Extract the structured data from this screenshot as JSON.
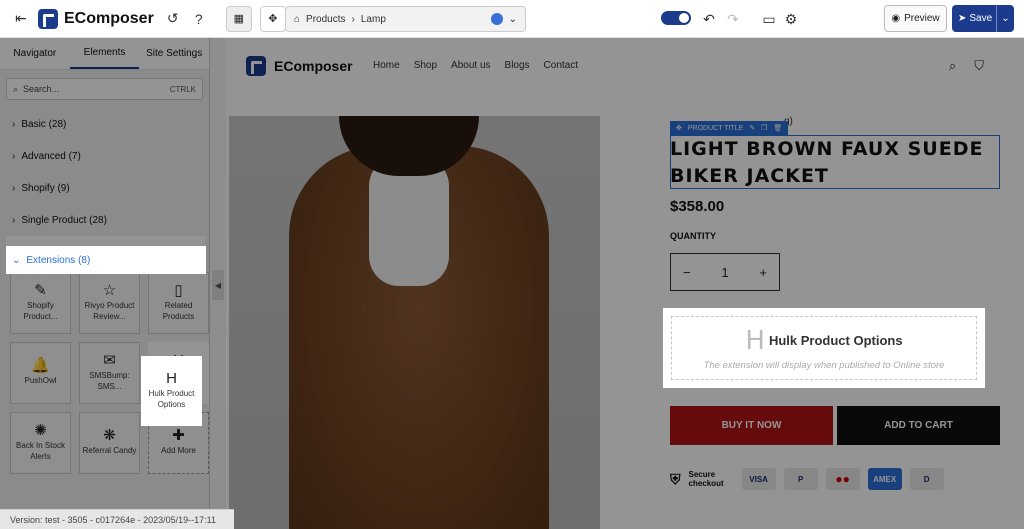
{
  "topbar": {
    "brand": "EComposer",
    "breadcrumb_root": "Products",
    "breadcrumb_page": "Lamp",
    "preview_label": "Preview",
    "save_label": "Save"
  },
  "left": {
    "tabs": [
      "Navigator",
      "Elements",
      "Site Settings"
    ],
    "search_placeholder": "Search...",
    "search_shortcut": "CTRLK",
    "categories": [
      {
        "label": "Basic (28)"
      },
      {
        "label": "Advanced (7)"
      },
      {
        "label": "Shopify (9)"
      },
      {
        "label": "Single Product (28)"
      },
      {
        "label": "Extensions (8)"
      }
    ],
    "cards": [
      {
        "label": "Shopify Product...",
        "icon": "✎"
      },
      {
        "label": "Rivyo Product Review...",
        "icon": "☆"
      },
      {
        "label": "Related Products",
        "icon": "▯"
      },
      {
        "label": "PushOwl",
        "icon": "🔔"
      },
      {
        "label": "SMSBump: SMS...",
        "icon": "✉"
      },
      {
        "label": "Hulk Product Options",
        "icon": "H"
      },
      {
        "label": "Back In Stock Alerts",
        "icon": "✺"
      },
      {
        "label": "Referral Candy",
        "icon": "❋"
      },
      {
        "label": "Add More",
        "icon": "✚"
      }
    ],
    "version": "Version: test - 3505 - c017264e - 2023/05/19--17:11"
  },
  "store": {
    "brand": "EComposer",
    "nav": [
      "Home",
      "Shop",
      "About us",
      "Blogs",
      "Contact"
    ],
    "rating_suffix": "g)",
    "title_toolbar": "PRODUCT TITLE",
    "product_title": "LIGHT BROWN FAUX SUEDE BIKER JACKET",
    "price": "$358.00",
    "quantity_label": "QUANTITY",
    "quantity_value": "1",
    "hulk_title": "Hulk Product Options",
    "hulk_h": "H",
    "hulk_sub": "The extension will display when published to Online store",
    "buy_now": "BUY IT NOW",
    "add_to_cart": "ADD TO CART",
    "secure_line1": "Secure",
    "secure_line2": "checkout",
    "payments": [
      "VISA",
      "P",
      "●●",
      "AMEX",
      "D"
    ]
  }
}
